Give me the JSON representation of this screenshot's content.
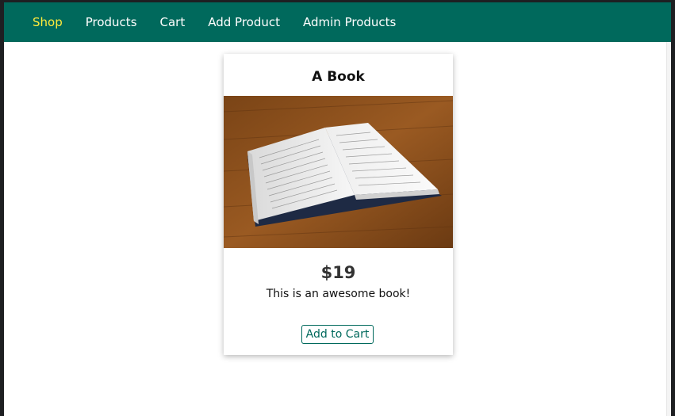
{
  "nav": {
    "items": [
      {
        "label": "Shop",
        "active": true
      },
      {
        "label": "Products",
        "active": false
      },
      {
        "label": "Cart",
        "active": false
      },
      {
        "label": "Add Product",
        "active": false
      },
      {
        "label": "Admin Products",
        "active": false
      }
    ]
  },
  "product": {
    "title": "A Book",
    "image_alt": "open-book-photo",
    "price": "$19",
    "description": "This is an awesome book!",
    "add_to_cart_label": "Add to Cart"
  },
  "colors": {
    "navbar": "#00695c",
    "nav_active": "#ffeb3b",
    "accent": "#00695c"
  }
}
